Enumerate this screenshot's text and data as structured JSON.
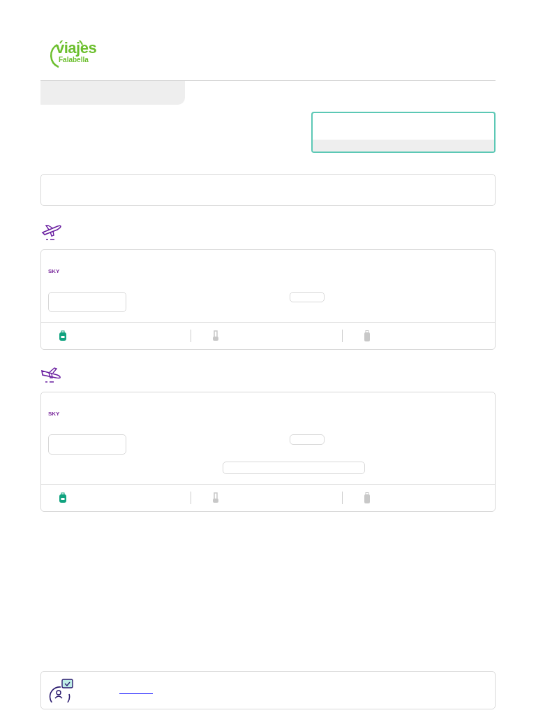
{
  "logo": {
    "brand": "viajes",
    "sub": "Falabella"
  },
  "flights": [
    {
      "kind": "departure",
      "airline": "SKY",
      "extra_box": false,
      "baggage": [
        {
          "kind": "backpack",
          "included": true
        },
        {
          "kind": "carry-on",
          "included": false
        },
        {
          "kind": "suitcase",
          "included": false
        }
      ]
    },
    {
      "kind": "arrival",
      "airline": "SKY",
      "extra_box": true,
      "baggage": [
        {
          "kind": "backpack",
          "included": true
        },
        {
          "kind": "carry-on",
          "included": false
        },
        {
          "kind": "suitcase",
          "included": false
        }
      ]
    }
  ]
}
